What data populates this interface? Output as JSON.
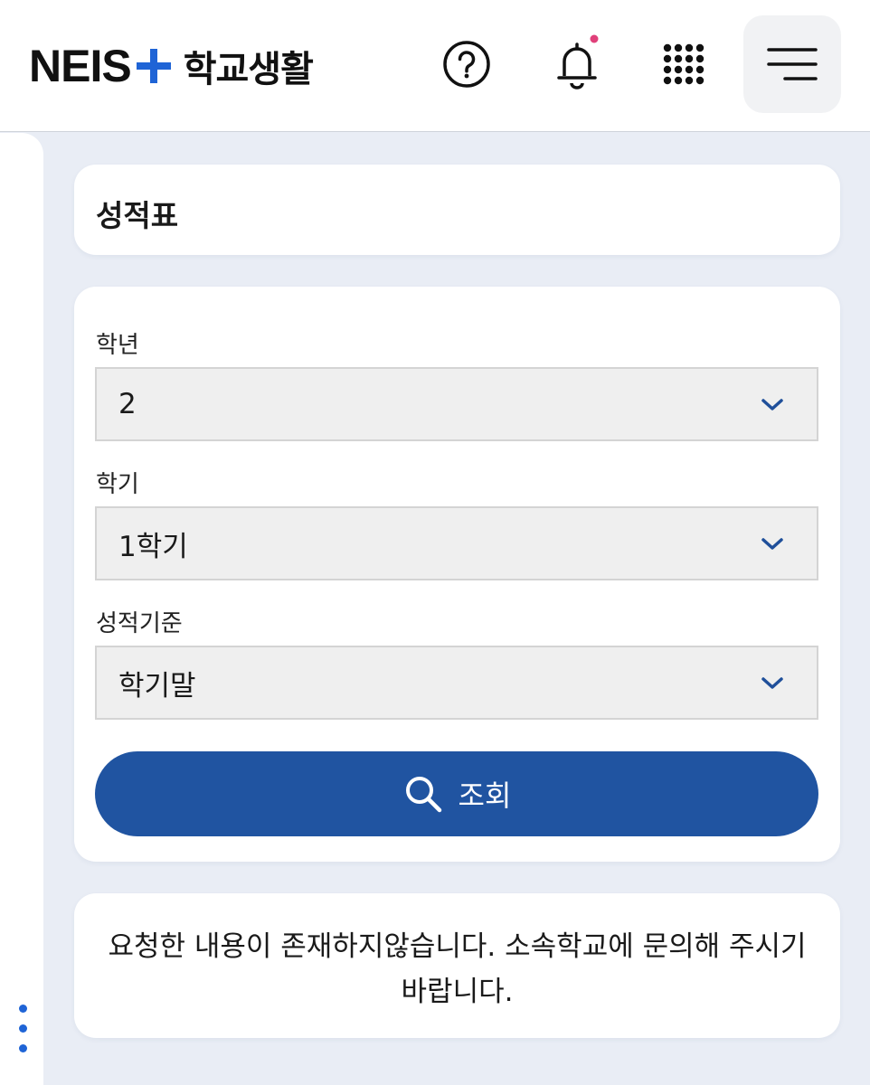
{
  "header": {
    "logo_text": "NEIS",
    "app_title": "학교생활",
    "icons": {
      "help": "help-circle-icon",
      "notifications": "bell-icon",
      "apps": "grid-dots-icon",
      "menu": "hamburger-menu-icon"
    },
    "notification_dot_color": "#e0407a",
    "brand_color": "#1f64d6"
  },
  "page": {
    "title": "성적표"
  },
  "form": {
    "grade": {
      "label": "학년",
      "value": "2"
    },
    "semester": {
      "label": "학기",
      "value": "1학기"
    },
    "criteria": {
      "label": "성적기준",
      "value": "학기말"
    },
    "search_button": {
      "label": "조회",
      "icon": "search-icon",
      "color": "#2054a1"
    }
  },
  "message": {
    "text": "요청한 내용이 존재하지않습니다. 소속학교에 문의해 주시기 바랍니다."
  },
  "left_rail": {
    "handle_icon": "vertical-dots-icon"
  }
}
